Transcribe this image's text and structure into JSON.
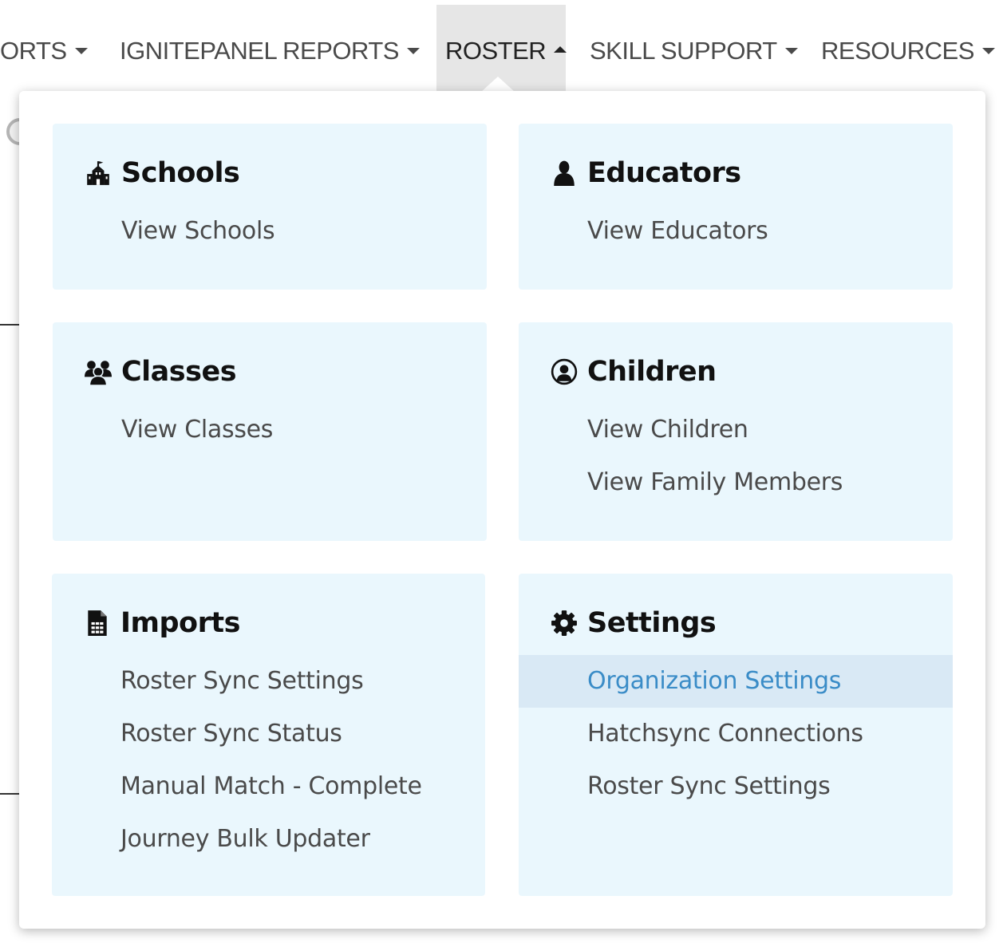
{
  "nav": {
    "items": [
      {
        "label": "ORTS"
      },
      {
        "label": "IGNITEPANEL REPORTS"
      },
      {
        "label": "ROSTER"
      },
      {
        "label": "SKILL SUPPORT"
      },
      {
        "label": "RESOURCES"
      }
    ]
  },
  "menu": {
    "schools": {
      "title": "Schools",
      "icon": "school-icon",
      "links": [
        "View Schools"
      ]
    },
    "educators": {
      "title": "Educators",
      "icon": "person-icon",
      "links": [
        "View Educators"
      ]
    },
    "classes": {
      "title": "Classes",
      "icon": "users-icon",
      "links": [
        "View Classes"
      ]
    },
    "children": {
      "title": "Children",
      "icon": "child-icon",
      "links": [
        "View Children",
        "View Family Members"
      ]
    },
    "imports": {
      "title": "Imports",
      "icon": "spreadsheet-icon",
      "links": [
        "Roster Sync Settings",
        "Roster Sync Status",
        "Manual Match - Complete",
        "Journey Bulk Updater"
      ]
    },
    "settings": {
      "title": "Settings",
      "icon": "gear-icon",
      "links": [
        "Organization Settings",
        "Hatchsync Connections",
        "Roster Sync Settings"
      ],
      "highlighted_link": "Organization Settings"
    }
  },
  "colors": {
    "card_bg": "#eaf7fd",
    "highlight_bg": "#d9e9f5",
    "highlight_text": "#3a8cc7",
    "active_tab_bg": "#e6e6e6"
  }
}
